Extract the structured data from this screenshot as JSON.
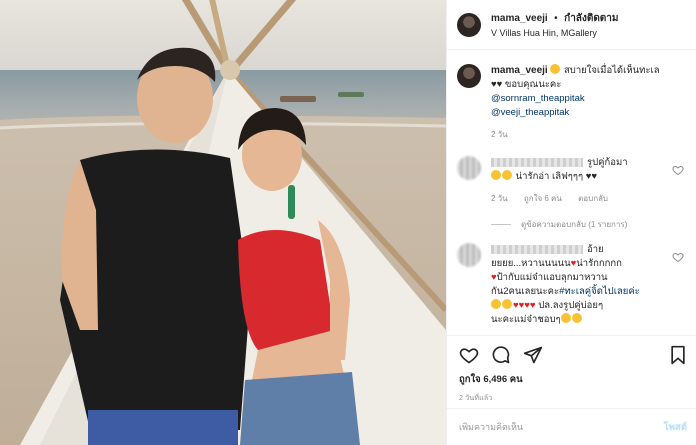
{
  "header": {
    "username": "mama_veeji",
    "separator": "•",
    "follow_label": "กำลังติดตาม",
    "location": "V Villas Hua Hin, MGallery"
  },
  "caption": {
    "username": "mama_veeji",
    "text": "สบายใจเมื่อได้เห็นทะเล",
    "text2": "ขอบคุณนะคะ",
    "mention1": "@sornram_theappitak",
    "mention2": "@veeji_theappitak",
    "age": "2 วัน"
  },
  "comment1": {
    "text_tail": "รูปคู่ก้อมา",
    "text2": "น่ารักอ่า เลิฟๆๆๆ",
    "age": "2 วัน",
    "likes": "ถูกใจ 6 คน",
    "reply": "ตอบกลับ",
    "view_replies": "ดูข้อความตอบกลับ (1 รายการ)"
  },
  "comment2": {
    "line1_tail": "อ้าย",
    "line2": "ยยยย...หวานนนนน",
    "line2b": "น่ารักกกกก",
    "line3": "ป้ากับแม่จ๋าแอบลุกมาหวาน",
    "line4a": "กัน2คนเลยนะคะ",
    "hashtag": "#ทะเลคู่จิ้ดไปเลยค่ะ",
    "line5": "ปล.ลงรูปคู่บ่อยๆ",
    "line6": "นะคะแม่จ๋าชอบๆ"
  },
  "footer": {
    "likes": "ถูกใจ 6,496 คน",
    "time": "2 วันที่แล้ว",
    "comment_placeholder": "เพิ่มความคิดเห็น",
    "post_label": "โพสต์"
  },
  "colors": {
    "link": "#003569",
    "secondary": "#8e8e8e",
    "heart": "#e02020",
    "post_disabled": "#b2dffc"
  },
  "icons": [
    "heart-icon",
    "comment-icon",
    "share-icon",
    "bookmark-icon"
  ]
}
